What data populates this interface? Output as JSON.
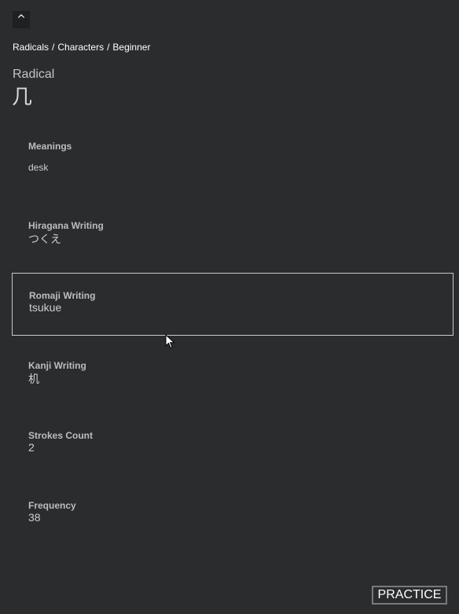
{
  "nav": {
    "up_label": "^"
  },
  "breadcrumb": [
    "Radicals",
    "Characters",
    "Beginner"
  ],
  "breadcrumb_separator": "/",
  "header": {
    "type_label": "Radical",
    "glyph": "几"
  },
  "fields": {
    "meanings": {
      "label": "Meanings",
      "value": "desk"
    },
    "hiragana": {
      "label": "Hiragana Writing",
      "value": "つくえ"
    },
    "romaji": {
      "label": "Romaji Writing",
      "value": "tsukue"
    },
    "kanji": {
      "label": "Kanji Writing",
      "value": "机"
    },
    "strokes": {
      "label": "Strokes Count",
      "value": "2"
    },
    "frequency": {
      "label": "Frequency",
      "value": "38"
    }
  },
  "actions": {
    "practice_label": "PRACTICE"
  },
  "colors": {
    "background": "#2b2c2e",
    "text": "#d2d2d2",
    "selection_border": "#c9c9c9"
  },
  "icons": {
    "cursor": "mouse-pointer-icon"
  }
}
